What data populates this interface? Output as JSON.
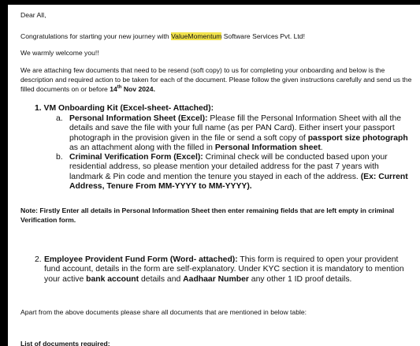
{
  "email": {
    "greeting": "Dear All,",
    "congrats_pre": "Congratulations for starting your new journey with ",
    "company_highlight": "ValueMomentum",
    "congrats_post": " Software Services Pvt. Ltd!",
    "welcome": "We warmly welcome you!!",
    "intro": "We are attaching few documents that need to be resend (soft copy) to us for completing your onboarding and below is the description and required action to be taken for each of the document. Please follow the given instructions carefully and send us the filled documents on or before ",
    "deadline_day": "14",
    "deadline_suffix": "th",
    "deadline_rest": " Nov 2024.",
    "item1": {
      "title": "1. VM Onboarding Kit (Excel-sheet- Attached):",
      "a_label": "a.",
      "a_title": "Personal Information Sheet (Excel):",
      "a_text1": " Please fill the Personal Information Sheet with all the details and save the file with your full name (as per PAN Card). Either insert your passport photograph in the provision given in the file or send a soft copy of ",
      "a_bold1": "passport size photograph",
      "a_text2": " as an attachment along with the filled in ",
      "a_bold2": "Personal Information sheet",
      "a_text3": ".",
      "b_label": "b.",
      "b_title": "Criminal Verification Form (Excel):",
      "b_text": " Criminal check will be conducted based upon your residential address, so please mention your detailed address for the past 7 years with landmark & Pin code and mention the tenure you stayed in each of the address. ",
      "b_bold": "(Ex: Current Address, Tenure From MM-YYYY to MM-YYYY)."
    },
    "note": "Note: Firstly Enter all details in Personal Information Sheet then enter remaining fields that are left empty in criminal Verification form.",
    "item2": {
      "label": "2.",
      "title": "Employee Provident Fund Form (Word- attached):",
      "text1": " This form is required to open your provident fund account, details in the form are self-explanatory. Under KYC section it is mandatory to mention your active ",
      "bold1": "bank account",
      "text2": " details and ",
      "bold2": "Aadhaar Number",
      "text3": " any other 1 ID proof details."
    },
    "apart": "Apart from the above documents please share all documents that are mentioned in below table:",
    "list_heading": "List of documents required:"
  },
  "colors": {
    "highlight": "#f2e34c",
    "background": "#000000",
    "paper": "#ffffff"
  }
}
